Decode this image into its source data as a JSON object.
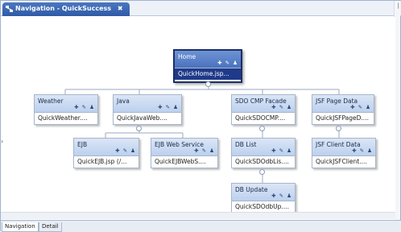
{
  "editor": {
    "tab_label": "Navigation - QuickSuccess",
    "close_glyph": "✖"
  },
  "bottom_tabs": [
    "Navigation",
    "Detail"
  ],
  "node_icons": "✚ ✎ ♟",
  "nodes": {
    "home": {
      "name": "Home",
      "page": "QuickHome.jsp..."
    },
    "weather": {
      "name": "Weather",
      "page": "QuickWeather...."
    },
    "java": {
      "name": "Java",
      "page": "QuickJavaWeb...."
    },
    "sdo_cmp": {
      "name": "SDO CMP Facade",
      "page": "QuickSDOCMP...."
    },
    "jsf_page": {
      "name": "JSF Page Data",
      "page": "QuickJSFPageD...."
    },
    "ejb": {
      "name": "EJB",
      "page": "QuickEJB.jsp (/..."
    },
    "ejb_ws": {
      "name": "EJB Web Service",
      "page": "QuickEJBWebS...."
    },
    "db_list": {
      "name": "DB List",
      "page": "QuickSDOdbLis...."
    },
    "jsf_client": {
      "name": "JSF Client Data",
      "page": "QuickJSFClient...."
    },
    "db_update": {
      "name": "DB Update",
      "page": "QuickSDOdbUp...."
    }
  }
}
